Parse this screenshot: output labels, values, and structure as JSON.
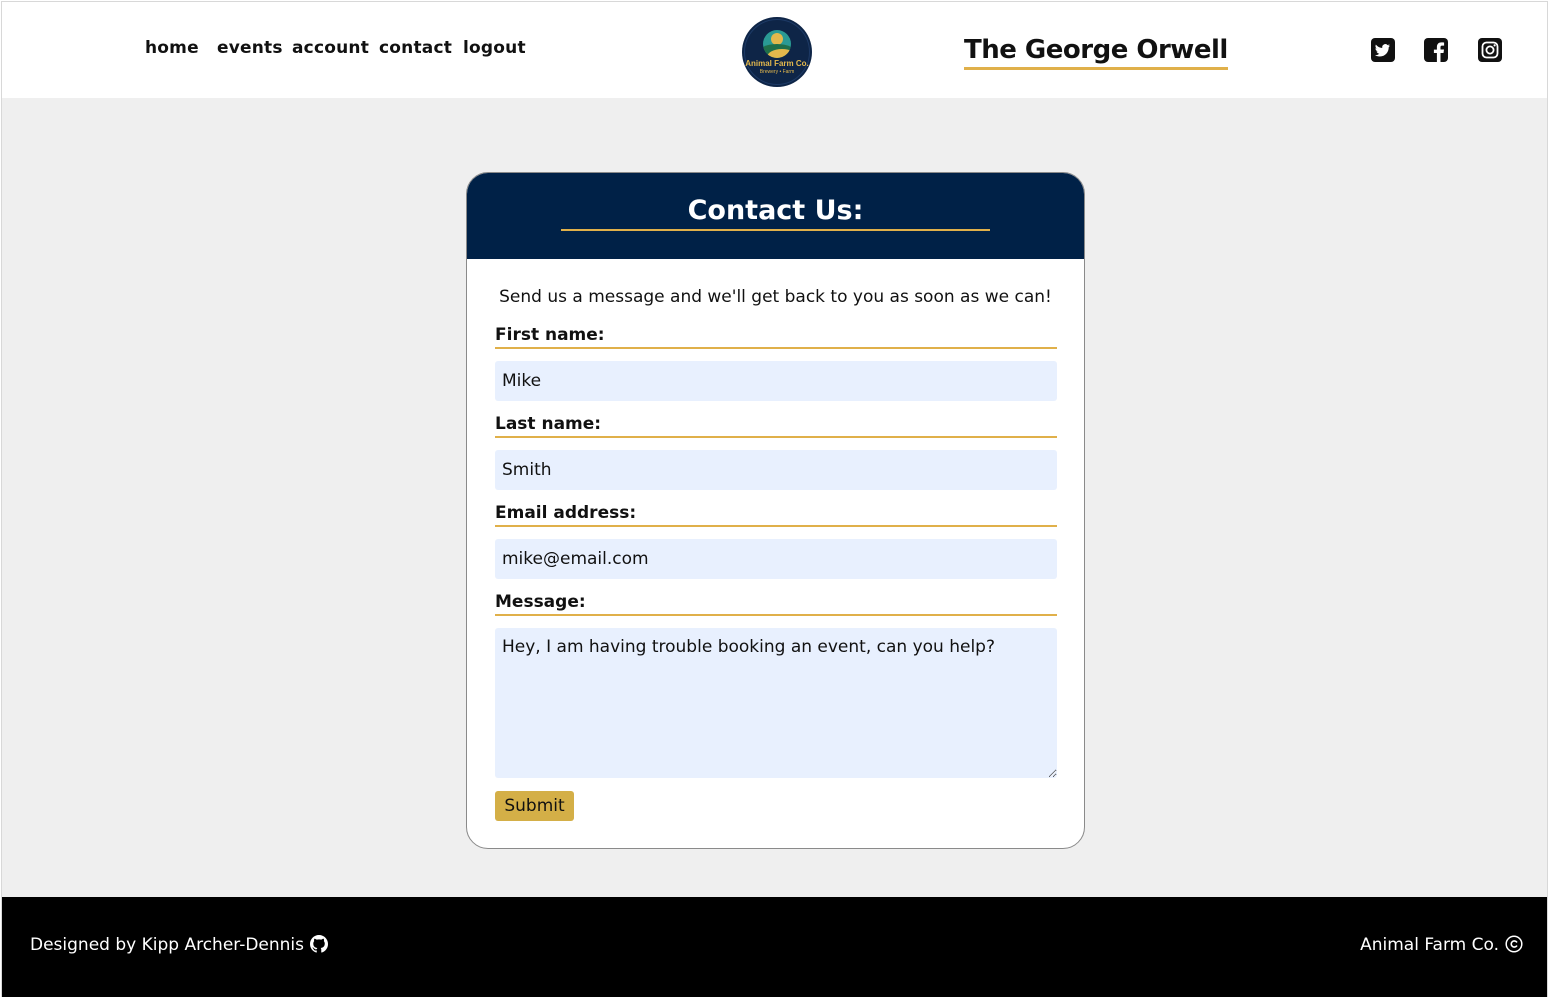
{
  "nav": {
    "items": [
      {
        "label": "home"
      },
      {
        "label": "events"
      },
      {
        "label": "account"
      },
      {
        "label": "contact"
      },
      {
        "label": "logout"
      }
    ]
  },
  "header": {
    "logo": {
      "name": "Animal Farm Co.",
      "sub": "Brewery • Farm"
    },
    "brand": "The George Orwell",
    "social": [
      "twitter-icon",
      "facebook-icon",
      "instagram-icon"
    ]
  },
  "contact": {
    "title": "Contact Us:",
    "intro": "Send us a message and we'll get back to you as soon as we can!",
    "first_name": {
      "label": "First name:",
      "value": "Mike"
    },
    "last_name": {
      "label": "Last name:",
      "value": "Smith"
    },
    "email": {
      "label": "Email address:",
      "value": "mike@email.com"
    },
    "message": {
      "label": "Message:",
      "value": "Hey, I am having trouble booking an event, can you help?"
    },
    "submit_label": "Submit"
  },
  "footer": {
    "credit": "Designed by Kipp Archer-Dennis",
    "copyright": "Animal Farm Co."
  },
  "colors": {
    "navy": "#002147",
    "gold": "#e0b04a",
    "button": "#d4af47",
    "input_bg": "#e8f0fe",
    "page_bg": "#efefef"
  }
}
